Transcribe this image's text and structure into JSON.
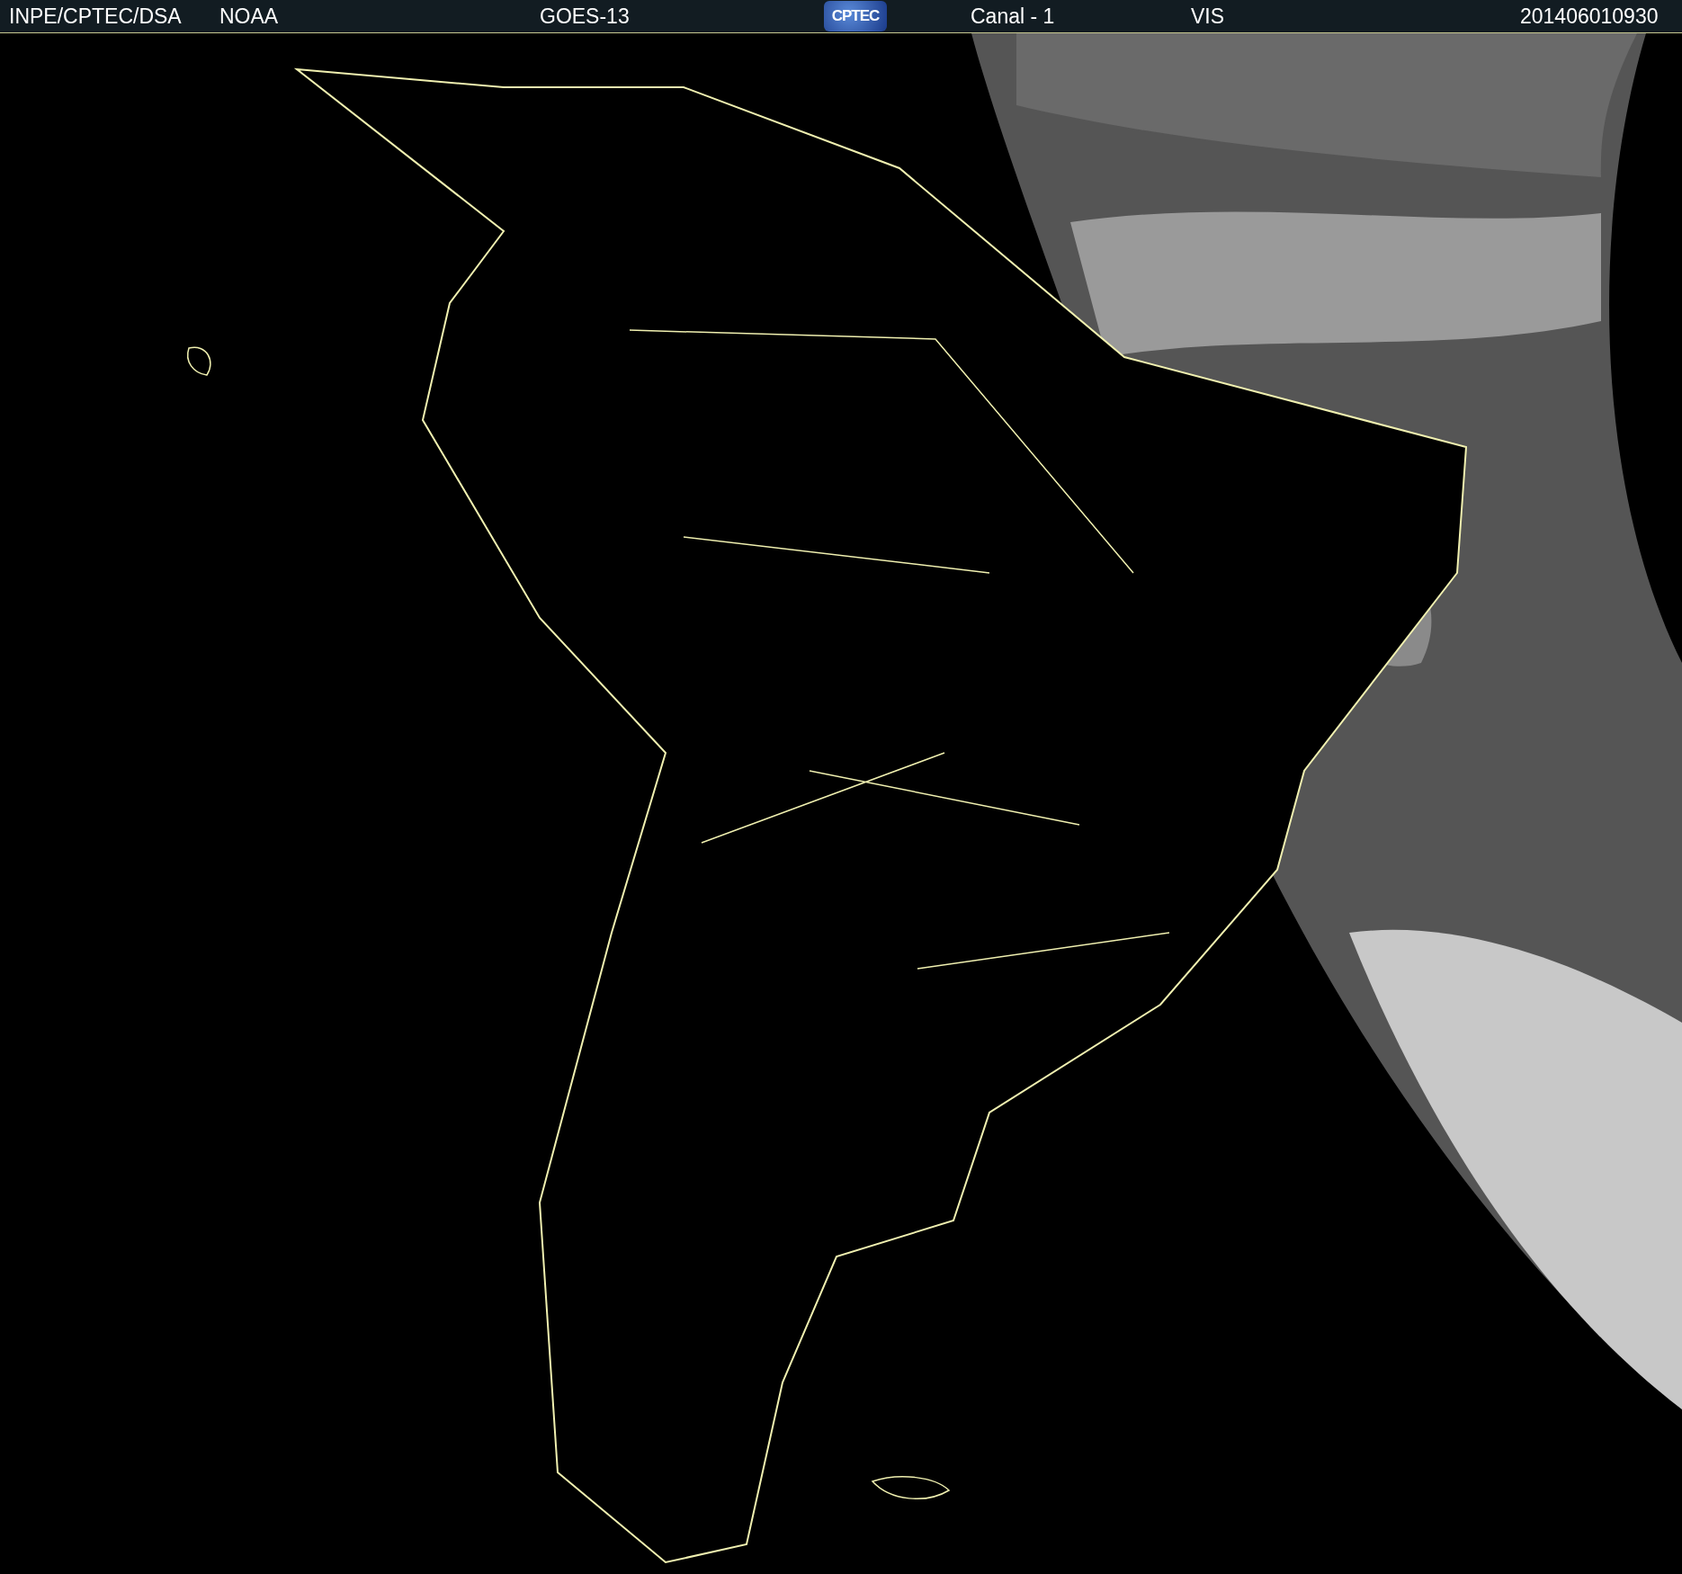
{
  "header": {
    "items": [
      {
        "kind": "text",
        "text": "INPE/CPTEC/DSA"
      },
      {
        "kind": "text",
        "text": "NOAA"
      },
      {
        "kind": "text",
        "text": "GOES-13"
      },
      {
        "kind": "logo",
        "text": "CPTEC"
      },
      {
        "kind": "text",
        "text": "Canal - 1"
      },
      {
        "kind": "text",
        "text": "VIS"
      },
      {
        "kind": "text",
        "text": "201406010930"
      }
    ]
  }
}
